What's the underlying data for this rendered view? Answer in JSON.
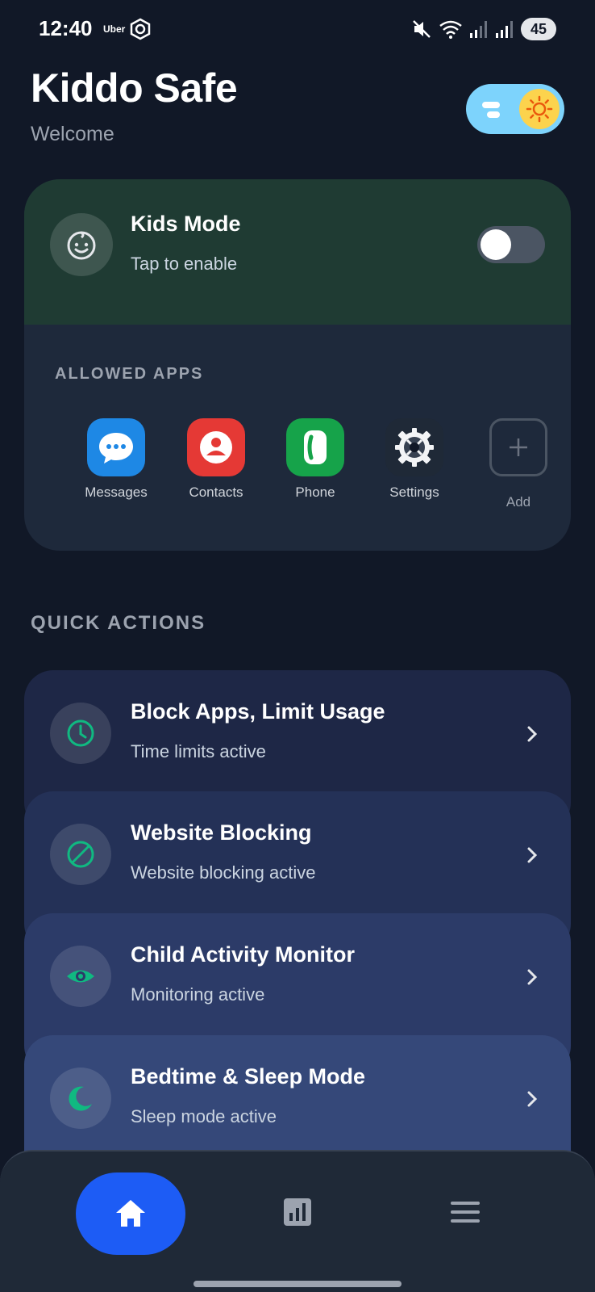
{
  "status_bar": {
    "time": "12:40",
    "carrier_label": "Uber",
    "battery": "45"
  },
  "header": {
    "title": "Kiddo Safe",
    "subtitle": "Welcome"
  },
  "kids_mode": {
    "title": "Kids Mode",
    "subtitle": "Tap to enable",
    "enabled": false,
    "allowed_label": "ALLOWED APPS",
    "apps": [
      {
        "label": "Messages",
        "icon": "messages-icon",
        "color": "#1e88e5"
      },
      {
        "label": "Contacts",
        "icon": "contacts-icon",
        "color": "#e53935"
      },
      {
        "label": "Phone",
        "icon": "phone-icon",
        "color": "#22c55e"
      },
      {
        "label": "Settings",
        "icon": "settings-icon",
        "color": "#1f2937"
      }
    ],
    "add_label": "Add"
  },
  "quick_actions": {
    "label": "QUICK ACTIONS",
    "items": [
      {
        "title": "Block Apps, Limit Usage",
        "subtitle": "Time limits active",
        "icon": "clock-icon",
        "color": "#1e2746"
      },
      {
        "title": "Website Blocking",
        "subtitle": "Website blocking active",
        "icon": "block-icon",
        "color": "#243157"
      },
      {
        "title": "Child Activity Monitor",
        "subtitle": "Monitoring active",
        "icon": "eye-icon",
        "color": "#2c3b68"
      },
      {
        "title": "Bedtime & Sleep Mode",
        "subtitle": "Sleep mode active",
        "icon": "moon-icon",
        "color": "#354879"
      }
    ]
  },
  "bottom_nav": {
    "items": [
      "home-icon",
      "stats-icon",
      "menu-icon"
    ],
    "accent": "#1d5cf5"
  },
  "colors": {
    "background": "#111827",
    "accent_green": "#10b981"
  }
}
